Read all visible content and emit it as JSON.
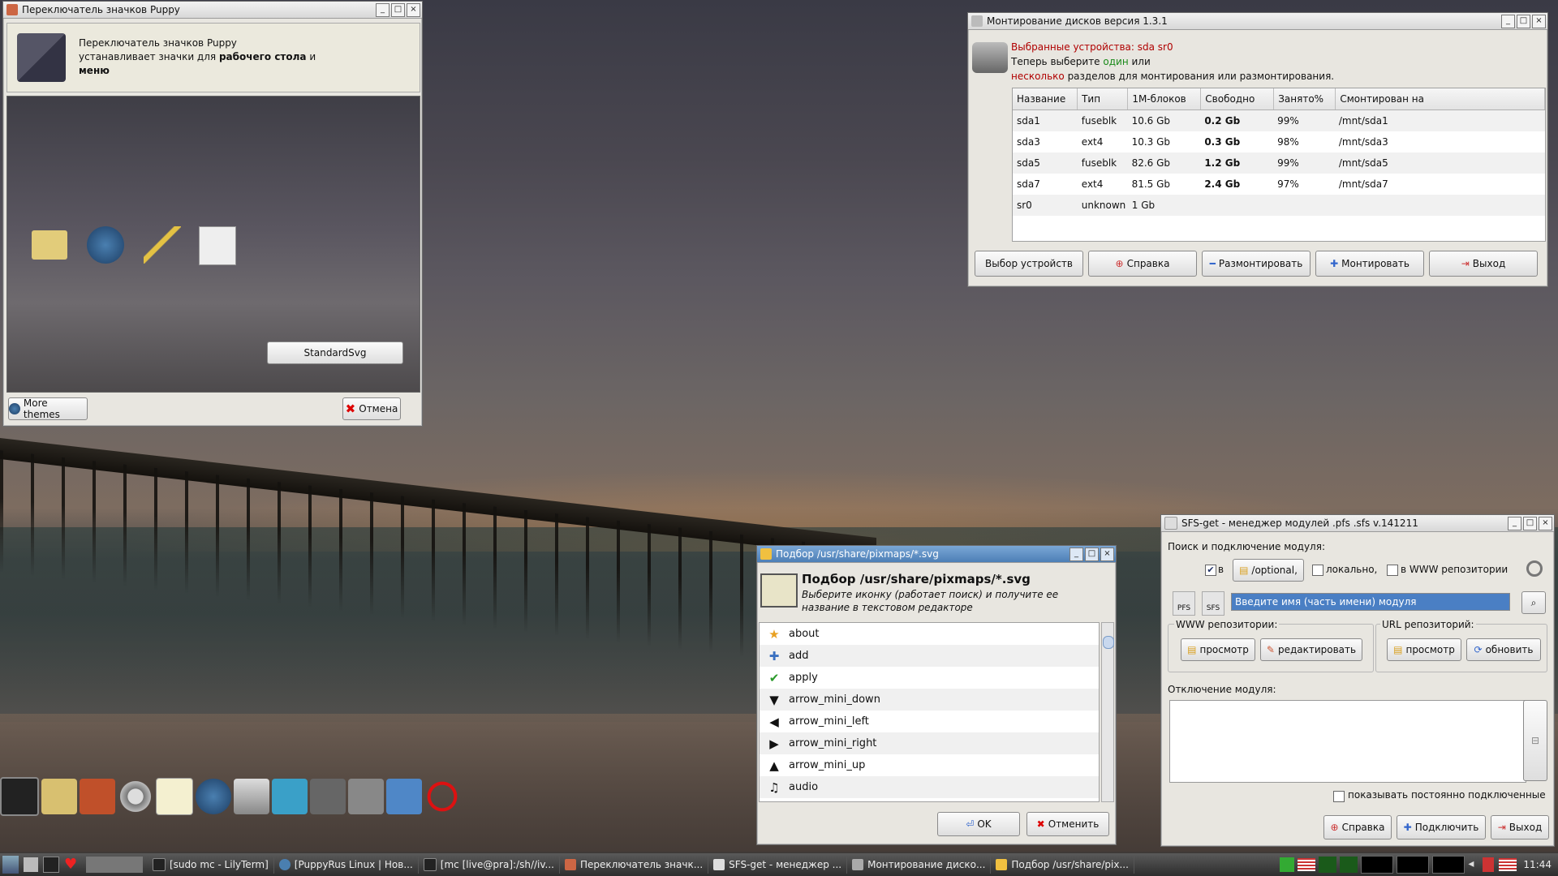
{
  "puppy_win": {
    "title": "Переключатель значков Puppy",
    "desc_line1": "Переключатель значков Puppy",
    "desc_line2a": "устанавливает значки для ",
    "desc_line2b": "рабочего стола",
    "desc_line2c": " и",
    "desc_line3": "меню",
    "theme_button": "StandardSvg",
    "more_themes": "More themes",
    "cancel": "Отмена"
  },
  "mount_win": {
    "title": "Монтирование дисков версия 1.3.1",
    "selected": "Выбранные устройства: sda sr0",
    "line2a": "Теперь выберите ",
    "line2b": "один",
    "line2c": " или",
    "line3a": "несколько",
    "line3b": " разделов для монтирования или размонтирования.",
    "columns": [
      "Название",
      "Тип",
      "1М-блоков",
      "Свободно",
      "Занято%",
      "Смонтирован на"
    ],
    "rows": [
      [
        "sda1",
        "fuseblk",
        "10.6 Gb",
        "0.2 Gb",
        "99%",
        "/mnt/sda1"
      ],
      [
        "sda3",
        "ext4",
        "10.3 Gb",
        "0.3 Gb",
        "98%",
        "/mnt/sda3"
      ],
      [
        "sda5",
        "fuseblk",
        "82.6 Gb",
        "1.2 Gb",
        "99%",
        "/mnt/sda5"
      ],
      [
        "sda7",
        "ext4",
        "81.5 Gb",
        "2.4 Gb",
        "97%",
        "/mnt/sda7"
      ],
      [
        "sr0",
        "unknown",
        "1 Gb",
        "",
        "",
        ""
      ]
    ],
    "btn_select": "Выбор устройств",
    "btn_help": "Справка",
    "btn_unmount": "Размонтировать",
    "btn_mount": "Монтировать",
    "btn_exit": "Выход"
  },
  "picker_win": {
    "title": "Подбор /usr/share/pixmaps/*.svg",
    "heading": "Подбор /usr/share/pixmaps/*.svg",
    "sub1": "Выберите иконку (работает поиск) и получите ее",
    "sub2": "название в текстовом редакторе",
    "items": [
      {
        "icon": "★",
        "label": "about"
      },
      {
        "icon": "✚",
        "label": "add"
      },
      {
        "icon": "✔",
        "label": "apply"
      },
      {
        "icon": "▼",
        "label": "arrow_mini_down"
      },
      {
        "icon": "◀",
        "label": "arrow_mini_left"
      },
      {
        "icon": "▶",
        "label": "arrow_mini_right"
      },
      {
        "icon": "▲",
        "label": "arrow_mini_up"
      },
      {
        "icon": "♫",
        "label": "audio"
      }
    ],
    "ok": "OK",
    "cancel": "Отменить"
  },
  "sfs_win": {
    "title": "SFS-get - менеджер модулей .pfs .sfs v.141211",
    "search_group": "Поиск и подключение модуля:",
    "in_label": "в",
    "optional_btn": "/optional,",
    "local_label": "локально,",
    "www_label": "в WWW репозитории",
    "pfs": "PFS",
    "sfs": "SFS",
    "search_placeholder": "Введите имя (часть имени) модуля",
    "www_repo_group": "WWW репозитории:",
    "view1": "просмотр",
    "edit": "редактировать",
    "url_repo_group": "URL репозиторий:",
    "view2": "просмотр",
    "refresh": "обновить",
    "disconnect_group": "Отключение модуля:",
    "show_permanent": "показывать постоянно подключенные",
    "help": "Справка",
    "connect": "Подключить",
    "exit": "Выход"
  },
  "taskbar": {
    "tasks": [
      "[sudo mc - LilyTerm]",
      "[PuppyRus Linux | Нов...",
      "[mc [live@pra]:/sh//iv...",
      "Переключатель значк...",
      "SFS-get - менеджер ...",
      "Монтирование диско...",
      "Подбор /usr/share/pix..."
    ],
    "clock": "11:44"
  },
  "colors": {
    "red_text": "#b00000",
    "green_text": "#1a8a1a",
    "active_title": "#4d7fb6"
  }
}
